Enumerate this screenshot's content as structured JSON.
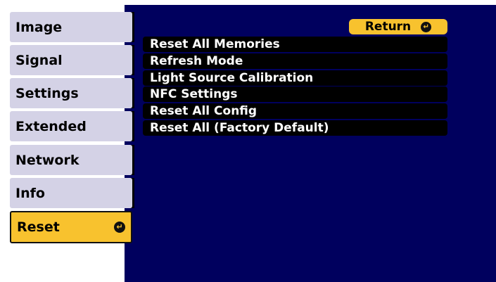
{
  "sidebar": {
    "items": [
      {
        "label": "Image"
      },
      {
        "label": "Signal"
      },
      {
        "label": "Settings"
      },
      {
        "label": "Extended"
      },
      {
        "label": "Network"
      },
      {
        "label": "Info"
      },
      {
        "label": "Reset"
      }
    ],
    "selected": "Reset"
  },
  "main": {
    "return_label": "Return",
    "items": [
      {
        "label": "Reset All Memories"
      },
      {
        "label": "Refresh Mode"
      },
      {
        "label": "Light Source Calibration"
      },
      {
        "label": "NFC Settings"
      },
      {
        "label": "Reset All Config"
      },
      {
        "label": "Reset All (Factory Default)"
      }
    ]
  },
  "colors": {
    "panel_bg": "#00005e",
    "tab_bg": "#d4d2e6",
    "accent": "#f8c22e"
  },
  "icons": {
    "enter": "enter-icon"
  }
}
